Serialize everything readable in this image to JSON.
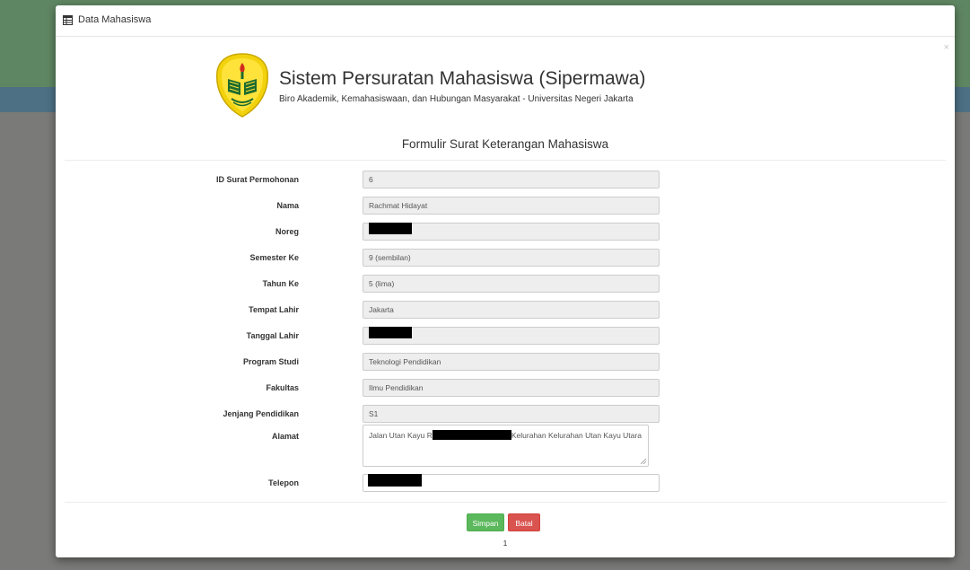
{
  "modal": {
    "title": "Data Mahasiswa",
    "close_label": "×"
  },
  "header": {
    "app_title": "Sistem Persuratan Mahasiswa (Sipermawa)",
    "app_subtitle": "Biro Akademik, Kemahasiswaan, dan Hubungan Masyarakat - Universitas Negeri Jakarta",
    "form_title": "Formulir Surat Keterangan Mahasiswa"
  },
  "form": {
    "id_label": "ID Surat Permohonan",
    "id_value": "6",
    "nama_label": "Nama",
    "nama_value": "Rachmat Hidayat",
    "noreg_label": "Noreg",
    "semester_label": "Semester Ke",
    "semester_value": "9 (sembilan)",
    "tahun_label": "Tahun Ke",
    "tahun_value": "5 (lima)",
    "tempat_label": "Tempat Lahir",
    "tempat_value": "Jakarta",
    "tanggal_label": "Tanggal Lahir",
    "prodi_label": "Program Studi",
    "prodi_value": "Teknologi Pendidikan",
    "fakultas_label": "Fakultas",
    "fakultas_value": "Ilmu Pendidikan",
    "jenjang_label": "Jenjang Pendidikan",
    "jenjang_value": "S1",
    "alamat_label": "Alamat",
    "alamat_prefix": "Jalan Utan Kayu R",
    "alamat_suffix": "Kelurahan Kelurahan Utan Kayu Utara",
    "telepon_label": "Telepon"
  },
  "actions": {
    "save_label": "Simpan",
    "cancel_label": "Batal",
    "page_number": "1"
  },
  "colors": {
    "save": "#5cb85c",
    "cancel": "#d9534f",
    "backdrop": "#7a7a78"
  }
}
